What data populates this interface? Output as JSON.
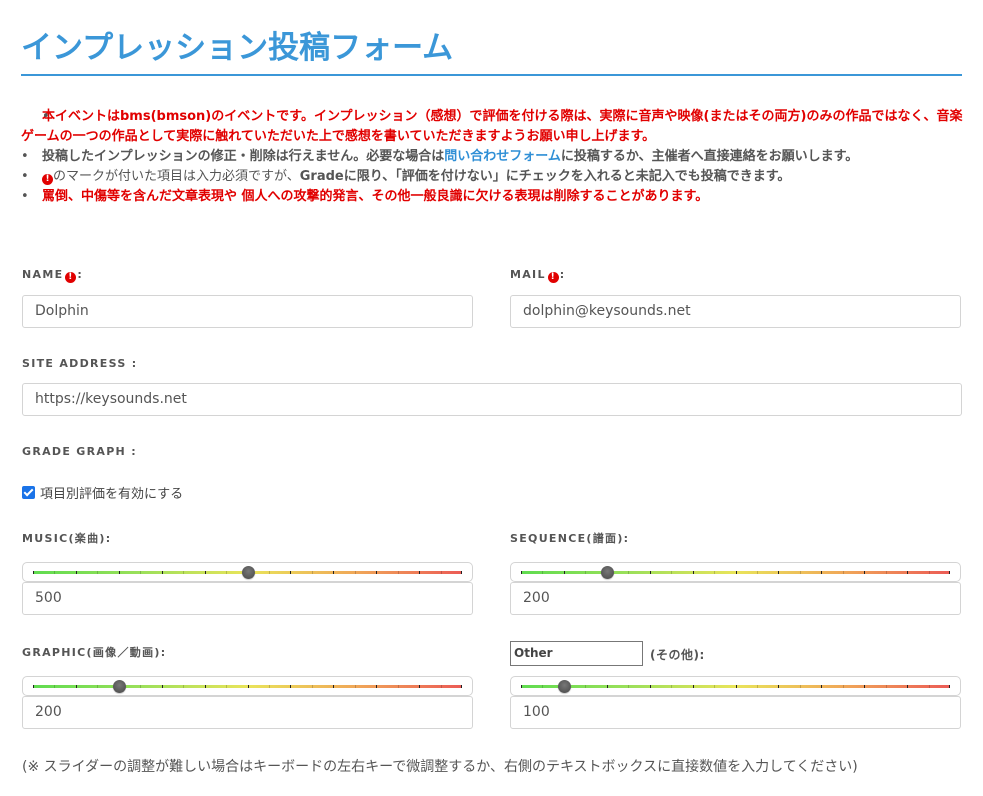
{
  "page": {
    "title": "インプレッション投稿フォーム",
    "accent_color": "#3b97d8",
    "warning_color": "#e10000"
  },
  "notes": [
    {
      "parts": [
        {
          "text": "本イベントはbms(bmson)のイベントです。インプレッション（感想）で評価を付ける際は、実際に音声や映像(またはその両方)のみの作品ではなく、音楽ゲームの一つの作品として実際に触れていただいた上で感想を書いていただきますようお願い申し上げます。",
          "style": "red"
        }
      ]
    },
    {
      "parts": [
        {
          "text": "投稿したインプレッションの修正・削除は行えません。必要な場合は",
          "style": "gray-bold"
        },
        {
          "text": "問い合わせフォーム",
          "style": "link"
        },
        {
          "text": "に投稿するか、主催者へ直接連絡をお願いします。",
          "style": "gray-bold"
        }
      ]
    },
    {
      "parts": [
        {
          "icon": "required-icon"
        },
        {
          "text": "のマークが付いた項目は入力必須ですが、",
          "style": "gray"
        },
        {
          "text": "Gradeに限り、「評価を付けない」にチェックを入れると未記入でも投稿できます。",
          "style": "gray-bold"
        }
      ]
    },
    {
      "parts": [
        {
          "text": "罵倒、中傷等を含んだ文章表現や 個人への攻撃的発言、その他一般良識に欠ける表現は削除することがあります。",
          "style": "red"
        }
      ]
    }
  ],
  "form": {
    "name": {
      "label": "NAME",
      "suffix": ":",
      "required": true,
      "value": "Dolphin"
    },
    "mail": {
      "label": "MAIL",
      "suffix": ":",
      "required": true,
      "value": "dolphin@keysounds.net"
    },
    "site": {
      "label": "SITE ADDRESS :",
      "value": "https://keysounds.net"
    },
    "grade_graph": {
      "label": "GRADE GRAPH :",
      "checkbox_label": "項目別評価を有効にする",
      "checkbox_checked": true
    },
    "sliders": {
      "min": 0,
      "max": 1000,
      "music": {
        "label": "MUSIC(楽曲):",
        "value": 500
      },
      "sequence": {
        "label": "SEQUENCE(譜面):",
        "value": 200
      },
      "graphic": {
        "label": "GRAPHIC(画像／動画):",
        "value": 200
      },
      "other": {
        "name_value": "Other",
        "suffix": "(その他):",
        "value": 100
      }
    },
    "footnote": "(※ スライダーの調整が難しい場合はキーボードの左右キーで微調整するか、右側のテキストボックスに直接数値を入力してください)"
  }
}
